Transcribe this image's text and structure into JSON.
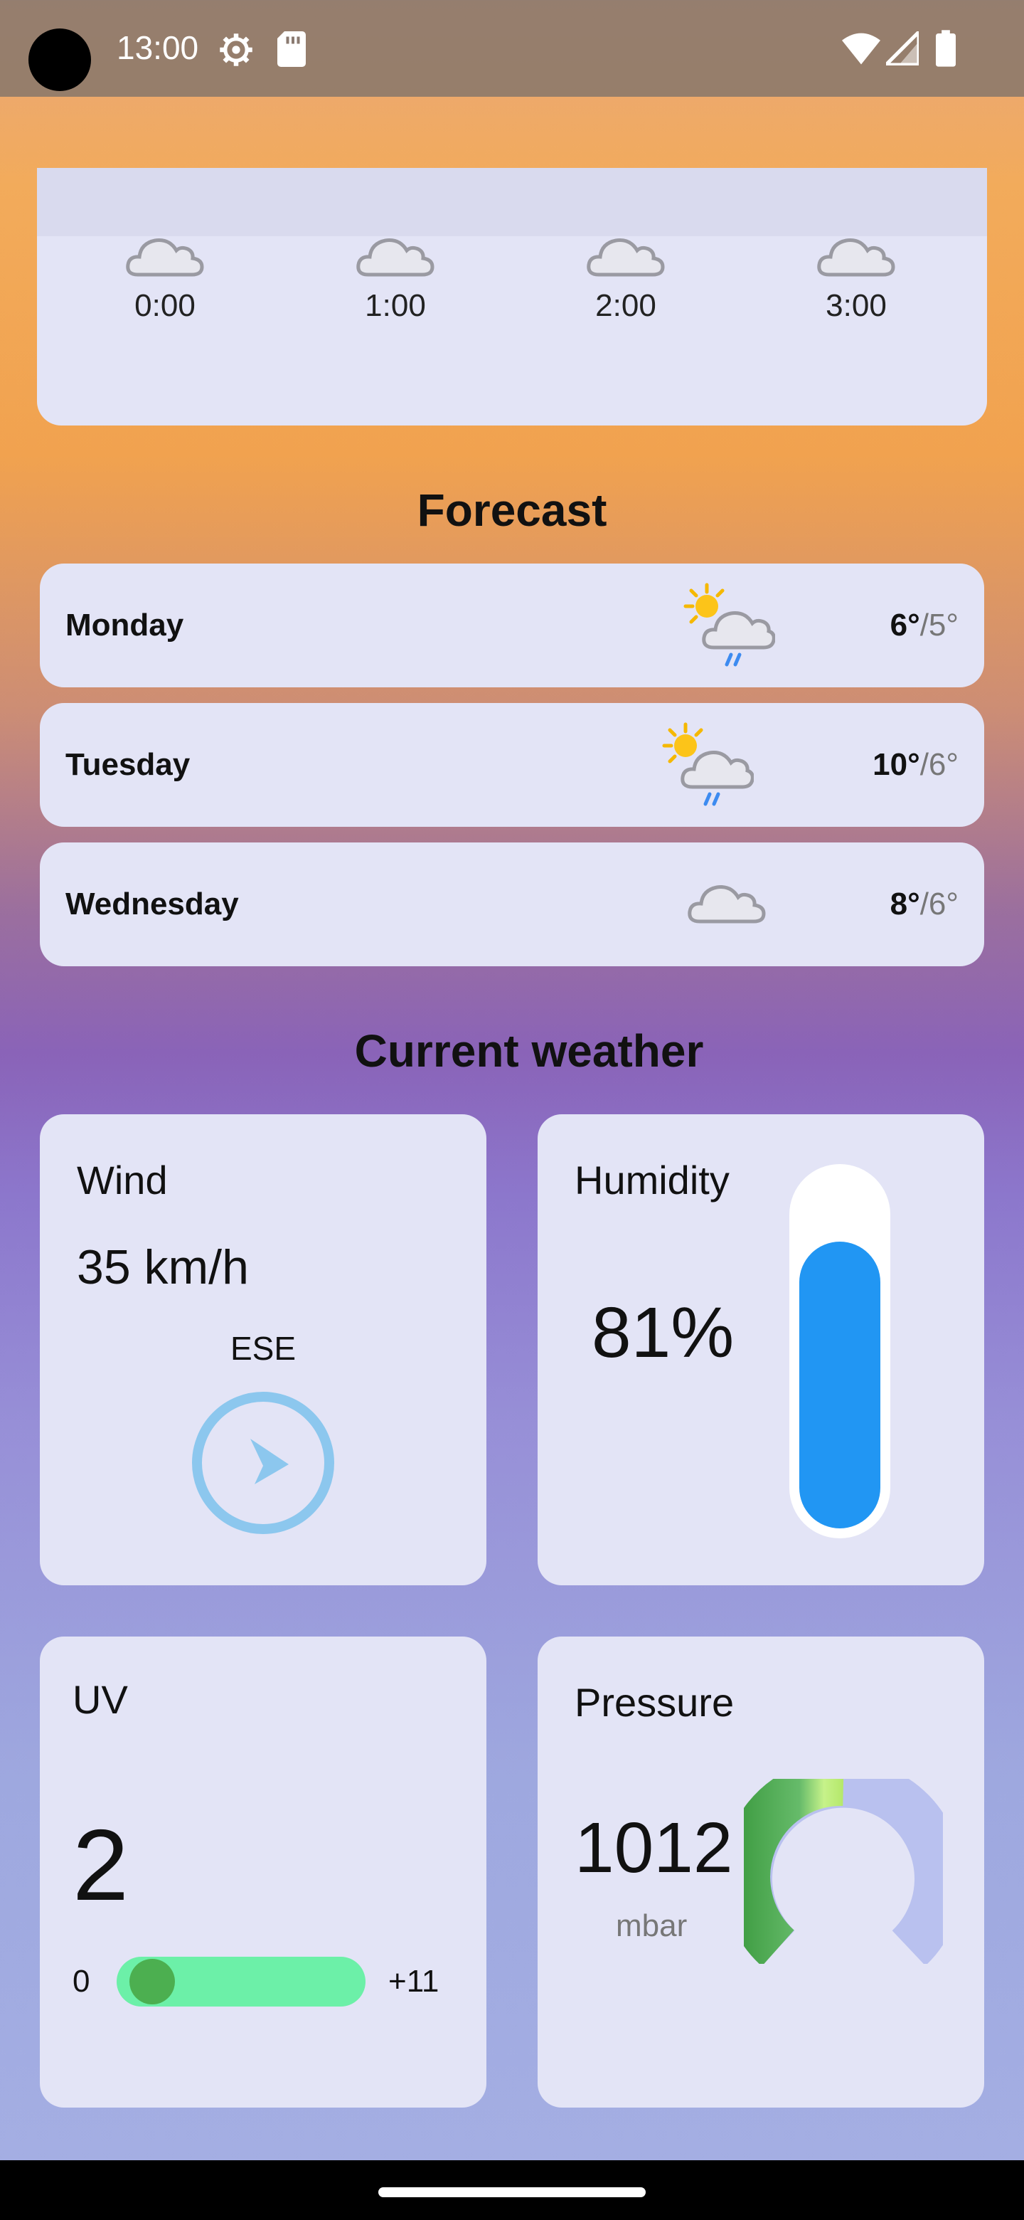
{
  "status_bar": {
    "time": "13:00",
    "icons": [
      "settings-gear-icon",
      "sd-card-icon",
      "wifi-icon",
      "cell-signal-icon",
      "battery-icon"
    ]
  },
  "hourly": {
    "items": [
      {
        "time": "0:00",
        "icon": "cloud-icon"
      },
      {
        "time": "1:00",
        "icon": "cloud-icon"
      },
      {
        "time": "2:00",
        "icon": "cloud-icon"
      },
      {
        "time": "3:00",
        "icon": "cloud-icon"
      }
    ]
  },
  "forecast": {
    "title": "Forecast",
    "days": [
      {
        "day": "Monday",
        "icon": "sun-cloud-rain-icon",
        "high": "6°",
        "low": "/5°"
      },
      {
        "day": "Tuesday",
        "icon": "sun-cloud-rain-icon",
        "high": "10°",
        "low": "/6°"
      },
      {
        "day": "Wednesday",
        "icon": "cloud-icon",
        "high": "8°",
        "low": "/6°"
      }
    ]
  },
  "current": {
    "title": "Current weather",
    "wind": {
      "label": "Wind",
      "speed": "35 km/h",
      "direction": "ESE",
      "icon": "wind-direction-arrow-icon"
    },
    "humidity": {
      "label": "Humidity",
      "value": "81%",
      "level": 0.81,
      "fill_color": "#2196f3"
    },
    "uv": {
      "label": "UV",
      "value": "2",
      "min": "0",
      "max": "+11",
      "level": 2,
      "scale_max": 11
    },
    "pressure": {
      "label": "Pressure",
      "value": "1012",
      "unit": "mbar"
    }
  },
  "colors": {
    "card": "#e3e4f6",
    "wind_accent": "#8cc7ee",
    "uv_track": "#6cf0a8",
    "uv_knob": "#4caf50",
    "gauge_rest": "#b9c1ef"
  }
}
